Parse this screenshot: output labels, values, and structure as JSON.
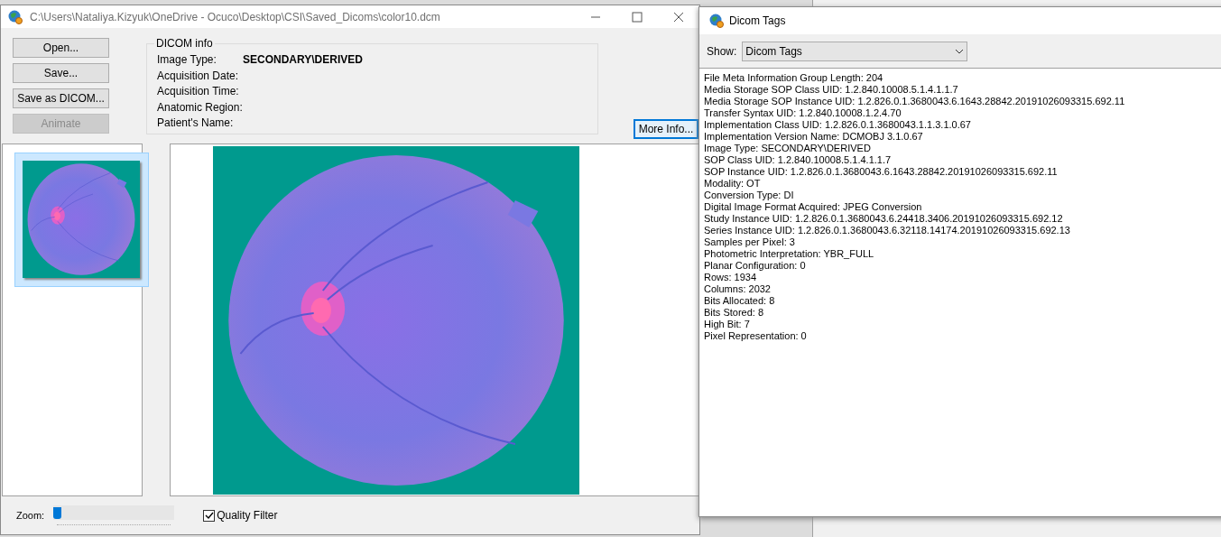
{
  "main_window": {
    "title": "C:\\Users\\Nataliya.Kizyuk\\OneDrive - Ocuco\\Desktop\\CSI\\Saved_Dicoms\\color10.dcm",
    "buttons": [
      {
        "label": "Open...",
        "disabled": false
      },
      {
        "label": "Save...",
        "disabled": false
      },
      {
        "label": "Save as DICOM...",
        "disabled": false
      },
      {
        "label": "Animate",
        "disabled": true
      }
    ],
    "dicom_info": {
      "title": "DICOM info",
      "fields": [
        {
          "label": "Image Type:",
          "value": "SECONDARY\\DERIVED"
        },
        {
          "label": "Acquisition Date:"
        },
        {
          "label": "Acquisition Time:"
        },
        {
          "label": "Anatomic Region:"
        },
        {
          "label": "Patient's Name:"
        }
      ]
    },
    "more_info_button": "More Info...",
    "thumbnails": [
      {
        "selected": true
      }
    ],
    "zoom": {
      "label": "Zoom:",
      "level": 0
    },
    "quality_filter": {
      "label": "Quality Filter",
      "checked": true
    }
  },
  "tags_window": {
    "title": "Dicom Tags",
    "show_label": "Show:",
    "show_value": "Dicom Tags",
    "lines": [
      "File Meta Information Group Length: 204",
      "Media Storage SOP Class UID: 1.2.840.10008.5.1.4.1.1.7",
      "Media Storage SOP Instance UID: 1.2.826.0.1.3680043.6.1643.28842.20191026093315.692.11",
      "Transfer Syntax UID: 1.2.840.10008.1.2.4.70",
      "Implementation Class UID: 1.2.826.0.1.3680043.1.1.3.1.0.67",
      "Implementation Version Name: DCMOBJ 3.1.0.67",
      "Image Type: SECONDARY\\DERIVED",
      "SOP Class UID: 1.2.840.10008.5.1.4.1.1.7",
      "SOP Instance UID: 1.2.826.0.1.3680043.6.1643.28842.20191026093315.692.11",
      "Modality: OT",
      "Conversion Type: DI",
      "Digital Image Format Acquired: JPEG Conversion",
      "Study Instance UID: 1.2.826.0.1.3680043.6.24418.3406.20191026093315.692.12",
      "Series Instance UID: 1.2.826.0.1.3680043.6.32118.14174.20191026093315.692.13",
      "Samples per Pixel: 3",
      "Photometric Interpretation: YBR_FULL",
      "Planar Configuration: 0",
      "Rows: 1934",
      "Columns: 2032",
      "Bits Allocated: 8",
      "Bits Stored: 8",
      "High Bit: 7",
      "Pixel Representation: 0"
    ]
  }
}
